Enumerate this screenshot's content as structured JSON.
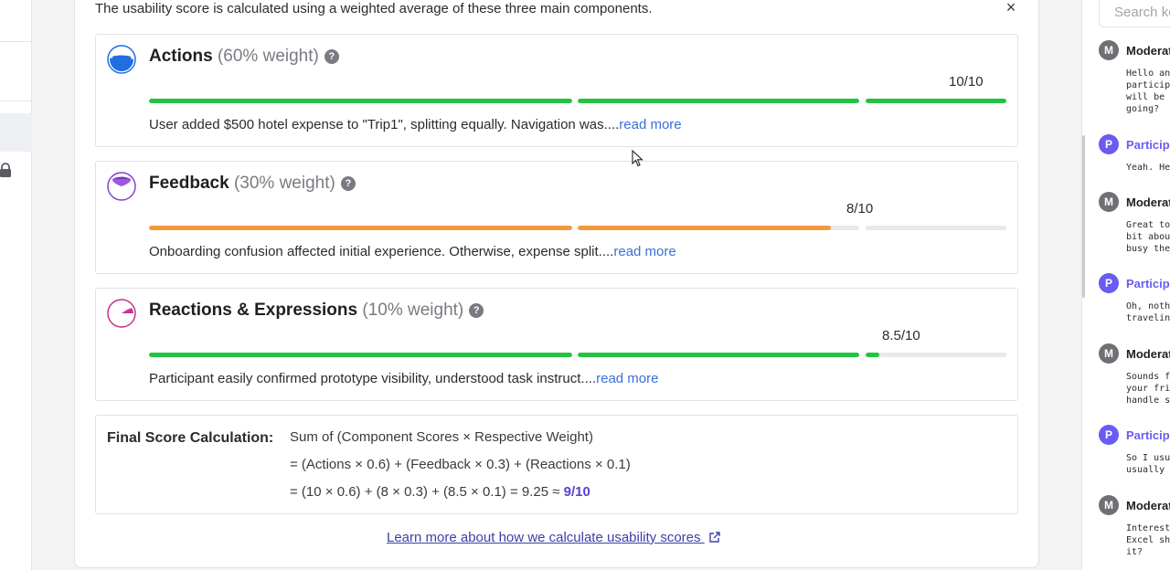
{
  "modal": {
    "intro": "The usability score is calculated using a weighted average of these three main components.",
    "close_label": "×",
    "help_glyph": "?",
    "components": [
      {
        "title": "Actions",
        "weight": "(60% weight)",
        "score_text": "10/10",
        "score": 10,
        "bar_color": "#22c341",
        "icon": "blue-gauge-icon",
        "description": "User added $500 hotel expense to \"Trip1\", splitting equally. Navigation was....",
        "read_more": "read more"
      },
      {
        "title": "Feedback",
        "weight": "(30% weight)",
        "score_text": "8/10",
        "score": 8,
        "bar_color": "#f19a3e",
        "icon": "purple-gauge-icon",
        "description": "Onboarding confusion affected initial experience. Otherwise, expense split....",
        "read_more": "read more"
      },
      {
        "title": "Reactions & Expressions",
        "weight": "(10% weight)",
        "score_text": "8.5/10",
        "score": 8.5,
        "bar_color": "#22c341",
        "icon": "pink-gauge-icon",
        "description": "Participant easily confirmed prototype visibility, understood task instruct....",
        "read_more": "read more"
      }
    ],
    "final": {
      "label": "Final Score Calculation:",
      "line1": "Sum of (Component Scores × Respective Weight)",
      "line2": "=  (Actions × 0.6) + (Feedback × 0.3) + (Reactions × 0.1)",
      "line3": "=  (10 × 0.6) + (8 × 0.3) + (8.5 × 0.1)  =  9.25  ≈ ",
      "result": "9/10"
    },
    "learn_more": "Learn more about how we calculate usability scores"
  },
  "chat": {
    "search_placeholder": "Search ke",
    "messages": [
      {
        "role": "moderator",
        "avatar": "M",
        "name": "Moderat",
        "text": "Hello and\nparticipa\nwill be g\ngoing?"
      },
      {
        "role": "participant",
        "avatar": "P",
        "name": "Participa",
        "text": "Yeah. Hey"
      },
      {
        "role": "moderator",
        "avatar": "M",
        "name": "Moderat",
        "text": "Great to\nbit about\nbusy thes"
      },
      {
        "role": "participant",
        "avatar": "P",
        "name": "Participa",
        "text": "Oh, nothi\ntraveling"
      },
      {
        "role": "moderator",
        "avatar": "M",
        "name": "Moderat",
        "text": "Sounds fu\nyour frie\nhandle sh"
      },
      {
        "role": "participant",
        "avatar": "P",
        "name": "Participa",
        "text": "So I usua\nusually w"
      },
      {
        "role": "moderator",
        "avatar": "M",
        "name": "Moderat",
        "text": "Interesti\nExcel she\nit?"
      }
    ]
  },
  "colors": {
    "moderator_avatar": "#6f6f74",
    "participant_avatar": "#6a5cf0",
    "participant_name": "#6a5cf0",
    "link": "#3b6fd8",
    "result": "#5b3fd0"
  }
}
